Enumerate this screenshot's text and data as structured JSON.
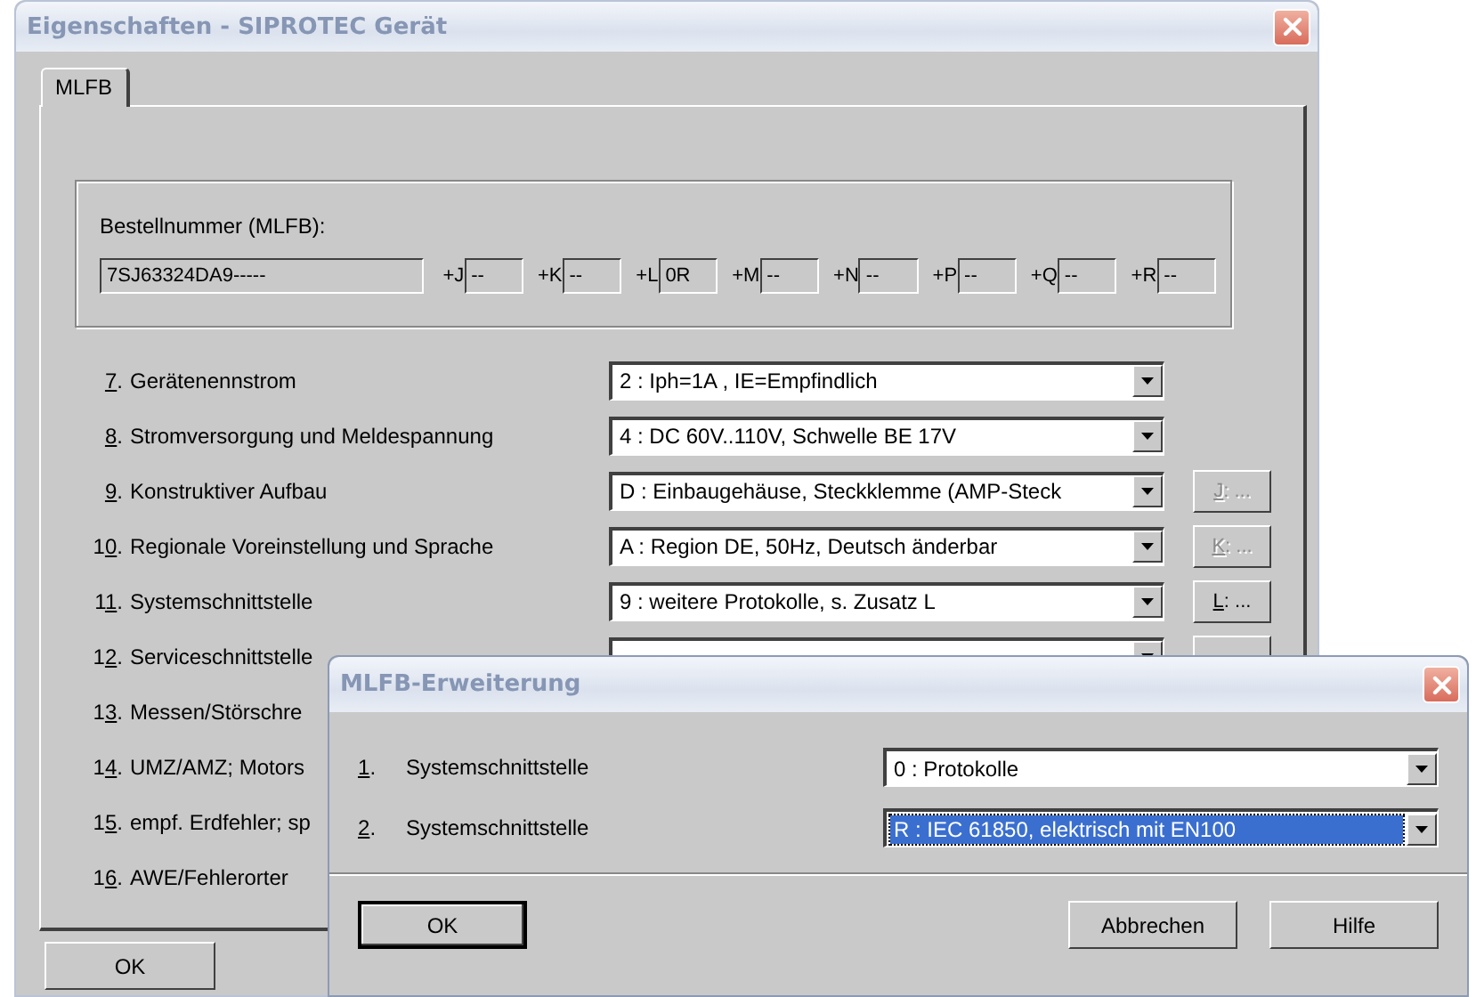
{
  "window": {
    "title": "Eigenschaften - SIPROTEC Gerät"
  },
  "tabs": [
    {
      "label": "MLFB",
      "selected": true
    }
  ],
  "order_number": {
    "label": "Bestellnummer (MLFB):",
    "value": "7SJ63324DA9-----",
    "extensions": [
      {
        "prefix": "+J",
        "value": "--"
      },
      {
        "prefix": "+K",
        "value": "--"
      },
      {
        "prefix": "+L",
        "value": "0R"
      },
      {
        "prefix": "+M",
        "value": "--"
      },
      {
        "prefix": "+N",
        "value": "--"
      },
      {
        "prefix": "+P",
        "value": "--"
      },
      {
        "prefix": "+Q",
        "value": "--"
      },
      {
        "prefix": "+R",
        "value": "--"
      }
    ]
  },
  "rows": [
    {
      "kind": "combo",
      "number": "7.",
      "label": "Gerätenennstrom",
      "value": "2 : Iph=1A , IE=Empfindlich"
    },
    {
      "kind": "combo",
      "number": "8.",
      "label": "Stromversorgung und Meldespannung",
      "value": "4 : DC 60V..110V, Schwelle BE 17V"
    },
    {
      "kind": "combo",
      "number": "9.",
      "label": "Konstruktiver Aufbau",
      "value": "D : Einbaugehäuse, Steckklemme (AMP-Steck",
      "button": {
        "label": "J: ...",
        "disabled": true
      }
    },
    {
      "kind": "combo",
      "number": "10.",
      "label": "Regionale Voreinstellung und Sprache",
      "value": "A : Region DE, 50Hz, Deutsch änderbar",
      "button": {
        "label": "K: ...",
        "disabled": true
      }
    },
    {
      "kind": "combo",
      "number": "11.",
      "label": "Systemschnittstelle",
      "value": "9 : weitere Protokolle, s. Zusatz L",
      "button": {
        "label": "L: ...",
        "disabled": false
      }
    },
    {
      "kind": "combo",
      "number": "12.",
      "label": "Serviceschnittstelle"
    },
    {
      "kind": "label",
      "number": "13.",
      "label": "Messen/Störschre"
    },
    {
      "kind": "label",
      "number": "14.",
      "label": "UMZ/AMZ; Motors"
    },
    {
      "kind": "label",
      "number": "15.",
      "label": "empf. Erdfehler; sp"
    },
    {
      "kind": "label",
      "number": "16.",
      "label": "AWE/Fehlerorter"
    }
  ],
  "buttons": [
    "OK"
  ],
  "dialog": {
    "title": "MLFB-Erweiterung",
    "rows": [
      {
        "number": "1.",
        "label": "Systemschnittstelle",
        "value": "0 : Protokolle",
        "focused": false
      },
      {
        "number": "2.",
        "label": "Systemschnittstelle",
        "value": "R : IEC 61850, elektrisch mit EN100",
        "focused": true
      }
    ],
    "buttons": [
      {
        "label": "OK",
        "default": true
      },
      {
        "label": "Abbrechen",
        "default": false
      },
      {
        "label": "Hilfe",
        "default": false
      }
    ]
  }
}
